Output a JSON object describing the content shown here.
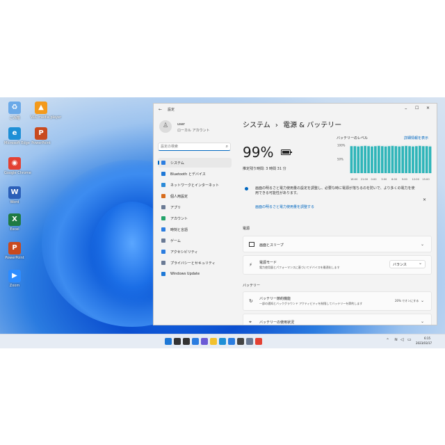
{
  "desktop": {
    "icons": [
      {
        "name": "ごみ箱",
        "color": "#6aa9e8",
        "glyph": "♻"
      },
      {
        "name": "VLC media player",
        "color": "#f39a1c",
        "glyph": "▲"
      },
      {
        "name": "Microsoft Edge",
        "color": "#1e8fd6",
        "glyph": "e"
      },
      {
        "name": "PowerPoint",
        "color": "#c84a1f",
        "glyph": "P"
      },
      {
        "name": "Google Chrome",
        "color": "#e34133",
        "glyph": "◉"
      },
      {
        "name": "Word",
        "color": "#2b5fb8",
        "glyph": "W"
      },
      {
        "name": "Excel",
        "color": "#1f7a43",
        "glyph": "X"
      },
      {
        "name": "PowerPoint",
        "color": "#c84a1f",
        "glyph": "P"
      },
      {
        "name": "Zoom",
        "color": "#2d8cff",
        "glyph": "▶"
      }
    ]
  },
  "window": {
    "app_title": "設定",
    "controls": {
      "minimize": "–",
      "maximize": "☐",
      "close": "✕"
    },
    "user": {
      "name": "user",
      "account_type": "ローカル アカウント"
    },
    "search": {
      "placeholder": "設定の検索",
      "icon": "search-icon"
    },
    "nav": [
      {
        "label": "システム",
        "color": "#2b7de0",
        "active": true
      },
      {
        "label": "Bluetooth とデバイス",
        "color": "#1e78d6",
        "active": false
      },
      {
        "label": "ネットワークとインターネット",
        "color": "#2a8ad8",
        "active": false
      },
      {
        "label": "個人用設定",
        "color": "#d76c1c",
        "active": false
      },
      {
        "label": "アプリ",
        "color": "#6a7a94",
        "active": false
      },
      {
        "label": "アカウント",
        "color": "#23a36a",
        "active": false
      },
      {
        "label": "時刻と言語",
        "color": "#2b7de0",
        "active": false
      },
      {
        "label": "ゲーム",
        "color": "#6a7a94",
        "active": false
      },
      {
        "label": "アクセシビリティ",
        "color": "#2b7de0",
        "active": false
      },
      {
        "label": "プライバシーとセキュリティ",
        "color": "#6a7a94",
        "active": false
      },
      {
        "label": "Windows Update",
        "color": "#1e78d6",
        "active": false
      }
    ],
    "breadcrumb": {
      "parent": "システム",
      "separator": "›",
      "current": "電源 & バッテリー"
    },
    "battery": {
      "percent": "99%",
      "level": 0.99,
      "estimate": "推定残り時間: 3 時間 31 分"
    },
    "chart": {
      "title": "バッテリーのレベル",
      "link": "詳細情報を表示",
      "y_labels": [
        "100%",
        "50%"
      ],
      "x_labels": [
        "18:00",
        "21:00",
        "0:00",
        "3:00",
        "6:00",
        "9:00",
        "12:00",
        "15:00"
      ]
    },
    "chart_data": {
      "type": "bar",
      "title": "バッテリーのレベル",
      "xlabel": "",
      "ylabel": "",
      "ylim": [
        0,
        100
      ],
      "categories": [
        "18:00",
        "21:00",
        "0:00",
        "3:00",
        "6:00",
        "9:00",
        "12:00",
        "15:00"
      ],
      "values": [
        97,
        97,
        96,
        97,
        98,
        97,
        96,
        97,
        98,
        97,
        96,
        97,
        98,
        97,
        96,
        97,
        98,
        97,
        96,
        97,
        98,
        97,
        97,
        96
      ]
    },
    "notice": {
      "text": "画面の明るさと電力使用量の設定を調整し、必要な時に電源が落ちるのを防いで、より多くの電力を使用できる可能性があります。",
      "link": "画面の明るさと電力使用量を調整する"
    },
    "section_power": "電源",
    "screen_sleep": {
      "label": "画面とスリープ"
    },
    "power_mode": {
      "label": "電源モード",
      "desc": "電力使用量とパフォーマンスに基づいてデバイスを最適化します",
      "value": "バランス"
    },
    "section_battery": "バッテリー",
    "battery_saver": {
      "label": "バッテリー節約機能",
      "desc": "一部の通知とバックグラウンド アクティビティを制限してバッテリーを節約します",
      "value": "20% でオンにする"
    },
    "battery_usage": {
      "label": "バッテリーの使用状況"
    }
  },
  "taskbar": {
    "icons": [
      {
        "name": "start-icon",
        "color": "#1e78d6"
      },
      {
        "name": "search-icon",
        "color": "#333333"
      },
      {
        "name": "task-view-icon",
        "color": "#333333"
      },
      {
        "name": "widgets-icon",
        "color": "#2b7de0"
      },
      {
        "name": "chat-icon",
        "color": "#6b5bd6"
      },
      {
        "name": "explorer-icon",
        "color": "#f2c12e"
      },
      {
        "name": "edge-icon",
        "color": "#1e8fd6"
      },
      {
        "name": "store-icon",
        "color": "#2b7de0"
      },
      {
        "name": "camera-icon",
        "color": "#444444"
      },
      {
        "name": "settings-icon",
        "color": "#6a7a94"
      },
      {
        "name": "chrome-icon",
        "color": "#e34133"
      }
    ],
    "tray": {
      "time": "6:15",
      "date": "2023/03/17"
    }
  },
  "colors": {
    "accent": "#0067c0",
    "bar": "#2fb5b9"
  }
}
